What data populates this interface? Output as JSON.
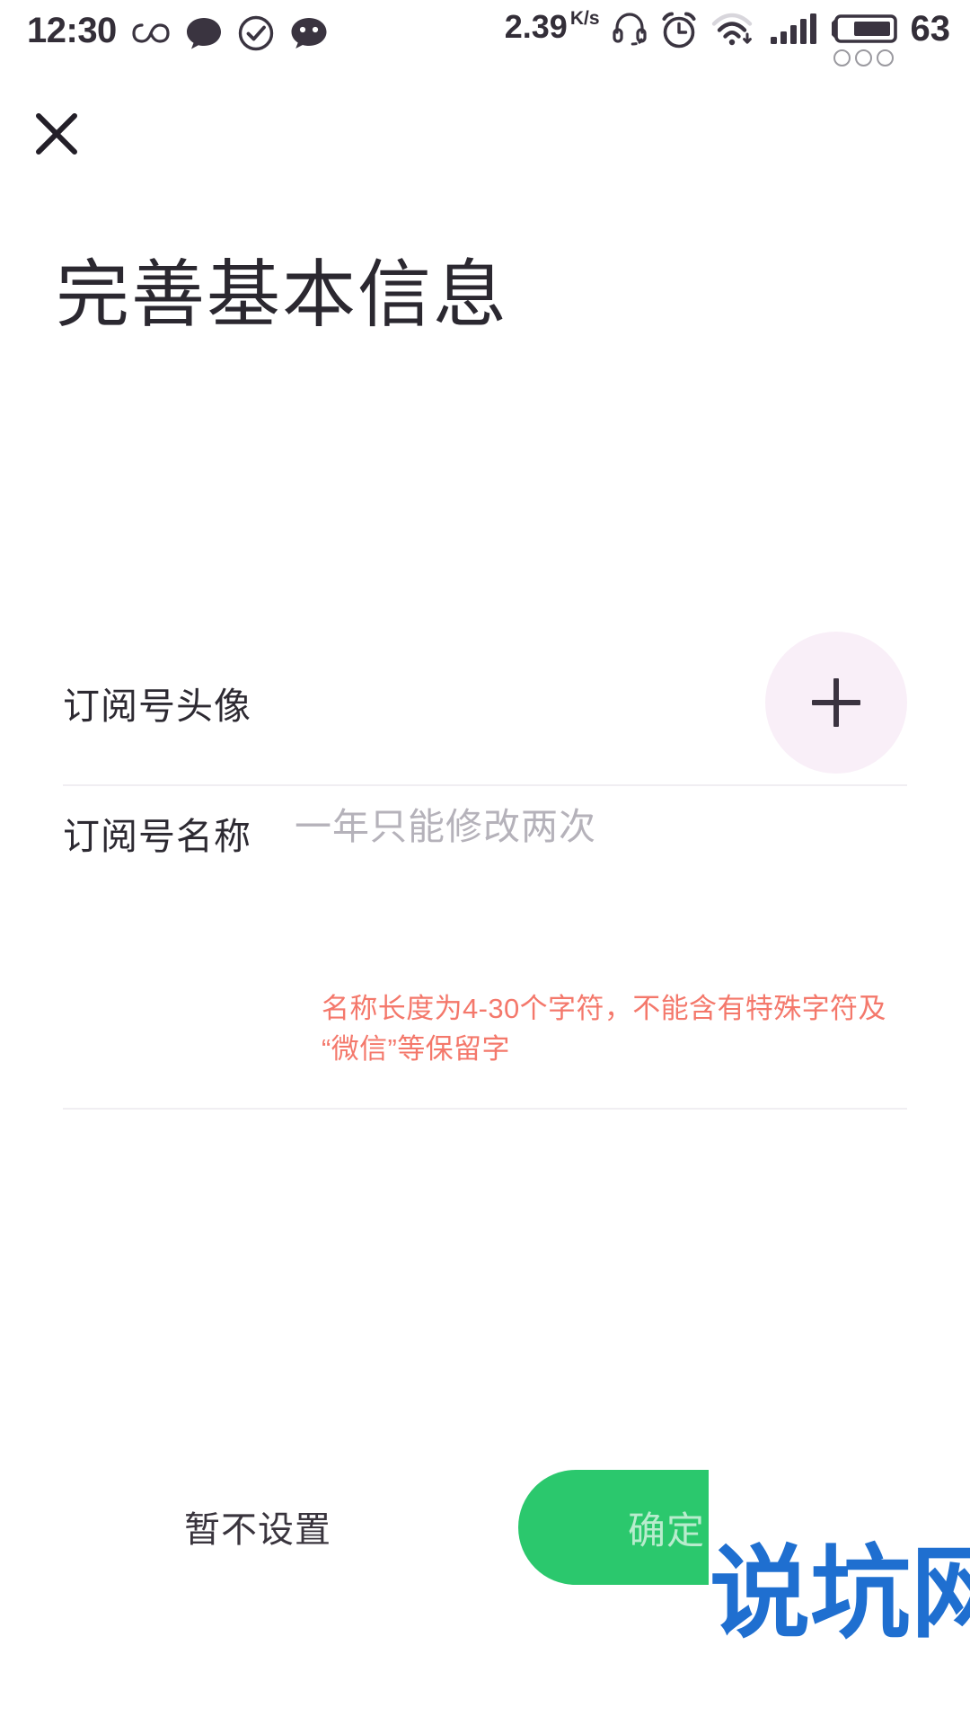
{
  "status_bar": {
    "clock": "12:30",
    "net_speed_value": "2.39",
    "net_speed_unit": "K/s",
    "battery_percent": "63",
    "left_icons": [
      "infinity-icon",
      "message-bubble-icon",
      "check-circle-icon",
      "wechat-icon"
    ],
    "right_icons": [
      "headset-icon",
      "alarm-clock-icon",
      "wifi-download-icon",
      "cellular-signal-icon",
      "battery-icon"
    ]
  },
  "header": {
    "close_icon": "close-icon",
    "title": "完善基本信息"
  },
  "form": {
    "avatar_row": {
      "label": "订阅号头像",
      "action_icon": "plus-icon",
      "avatar_bg_color": "#f9eff8"
    },
    "name_row": {
      "label": "订阅号名称",
      "value": "",
      "placeholder": "一年只能修改两次",
      "error": "名称长度为4-30个字符，不能含有特殊字符及“微信”等保留字",
      "error_color": "#f4786b"
    }
  },
  "footer": {
    "skip_label": "暂不设置",
    "confirm_label": "确定",
    "confirm_color": "#2bc86d"
  },
  "watermark": {
    "text": "说坑网",
    "color": "#1f6fd0"
  }
}
